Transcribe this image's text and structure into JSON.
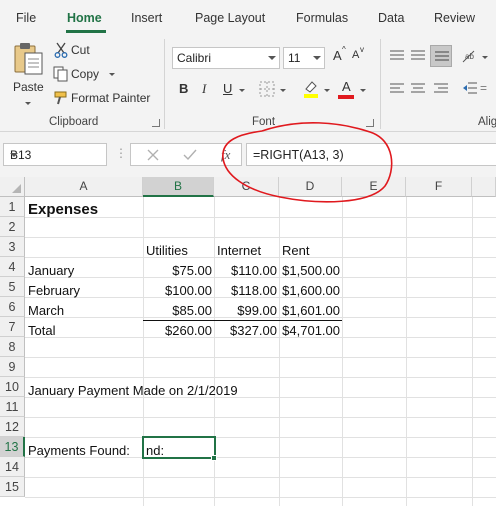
{
  "ribbon_tabs": [
    "File",
    "Home",
    "Insert",
    "Page Layout",
    "Formulas",
    "Data",
    "Review"
  ],
  "clipboard": {
    "paste_label": "Paste",
    "cut_label": "Cut",
    "copy_label": "Copy",
    "format_painter_label": "Format Painter",
    "group_label": "Clipboard"
  },
  "font": {
    "name": "Calibri",
    "size": "11",
    "grow_label": "A",
    "shrink_label": "A",
    "bold_label": "B",
    "italic_label": "I",
    "underline_label": "U",
    "font_color_label": "A",
    "group_label": "Font"
  },
  "alignment": {
    "group_label": "Alig"
  },
  "formula_bar": {
    "name_box": "B13",
    "formula": "=RIGHT(A13, 3)",
    "fx_label": "fx"
  },
  "sheet": {
    "columns": [
      "A",
      "B",
      "C",
      "D",
      "E",
      "F"
    ],
    "rows": [
      "1",
      "2",
      "3",
      "4",
      "5",
      "6",
      "7",
      "8",
      "9",
      "10",
      "11",
      "12",
      "13",
      "14",
      "15"
    ],
    "title": "Expenses",
    "headers": [
      "Utilities",
      "Internet",
      "Rent"
    ],
    "data_rows": [
      {
        "label": "January",
        "values": [
          "$75.00",
          "$110.00",
          "$1,500.00"
        ]
      },
      {
        "label": "February",
        "values": [
          "$100.00",
          "$118.00",
          "$1,600.00"
        ]
      },
      {
        "label": "March",
        "values": [
          "$85.00",
          "$99.00",
          "$1,601.00"
        ]
      },
      {
        "label": "Total",
        "values": [
          "$260.00",
          "$327.00",
          "$4,701.00"
        ]
      }
    ],
    "note": "January Payment Made on 2/1/2019",
    "payments_label": "Payments Found:",
    "active_cell_value": "nd:"
  },
  "colors": {
    "accent": "#217346",
    "annotation": "#e0191e"
  },
  "icons": [
    "paste-icon",
    "scissors-icon",
    "copy-icon",
    "brush-icon",
    "border-icon",
    "highlight-icon",
    "align-icon",
    "indent-icon"
  ]
}
